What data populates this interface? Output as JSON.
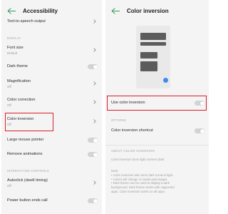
{
  "left": {
    "title": "Accessibility",
    "rows": [
      {
        "title": "Text-to-speech output",
        "sub": "",
        "control": "chevron"
      },
      {
        "title": "Font size",
        "sub": "Default",
        "control": "chevron"
      },
      {
        "title": "Dark theme",
        "sub": "",
        "control": "toggle"
      },
      {
        "title": "Magnification",
        "sub": "Off",
        "control": "chevron"
      },
      {
        "title": "Color correction",
        "sub": "Off",
        "control": "chevron"
      },
      {
        "title": "Color inversion",
        "sub": "Off",
        "control": "chevron"
      },
      {
        "title": "Large mouse pointer",
        "sub": "",
        "control": "toggle"
      },
      {
        "title": "Remove animations",
        "sub": "",
        "control": "toggle"
      },
      {
        "title": "Autoclick (dwell timing)",
        "sub": "Off",
        "control": "chevron"
      },
      {
        "title": "Power button ends call",
        "sub": "",
        "control": "toggle"
      }
    ],
    "sections": {
      "display": "DISPLAY",
      "interaction": "INTERACTION CONTROLS"
    }
  },
  "right": {
    "title": "Color inversion",
    "use_label": "Use color inversion",
    "options_section": "OPTIONS",
    "shortcut_label": "Color inversion shortcut",
    "about_section": "ABOUT COLOR INVERSION",
    "about_text": "Color inversion turns light screens dark.",
    "note_lines": [
      "Note:",
      "• Color inversion also turns dark screens light.",
      "• Colors will change in media and images.",
      "• Dark theme can be used to display a dark",
      "background. Dark theme works with supported",
      "apps. Color inversion works on all apps."
    ]
  },
  "colors": {
    "accent": "#2e9e5e",
    "highlight": "#d8202a",
    "preview_dot": "#3f8af0"
  }
}
